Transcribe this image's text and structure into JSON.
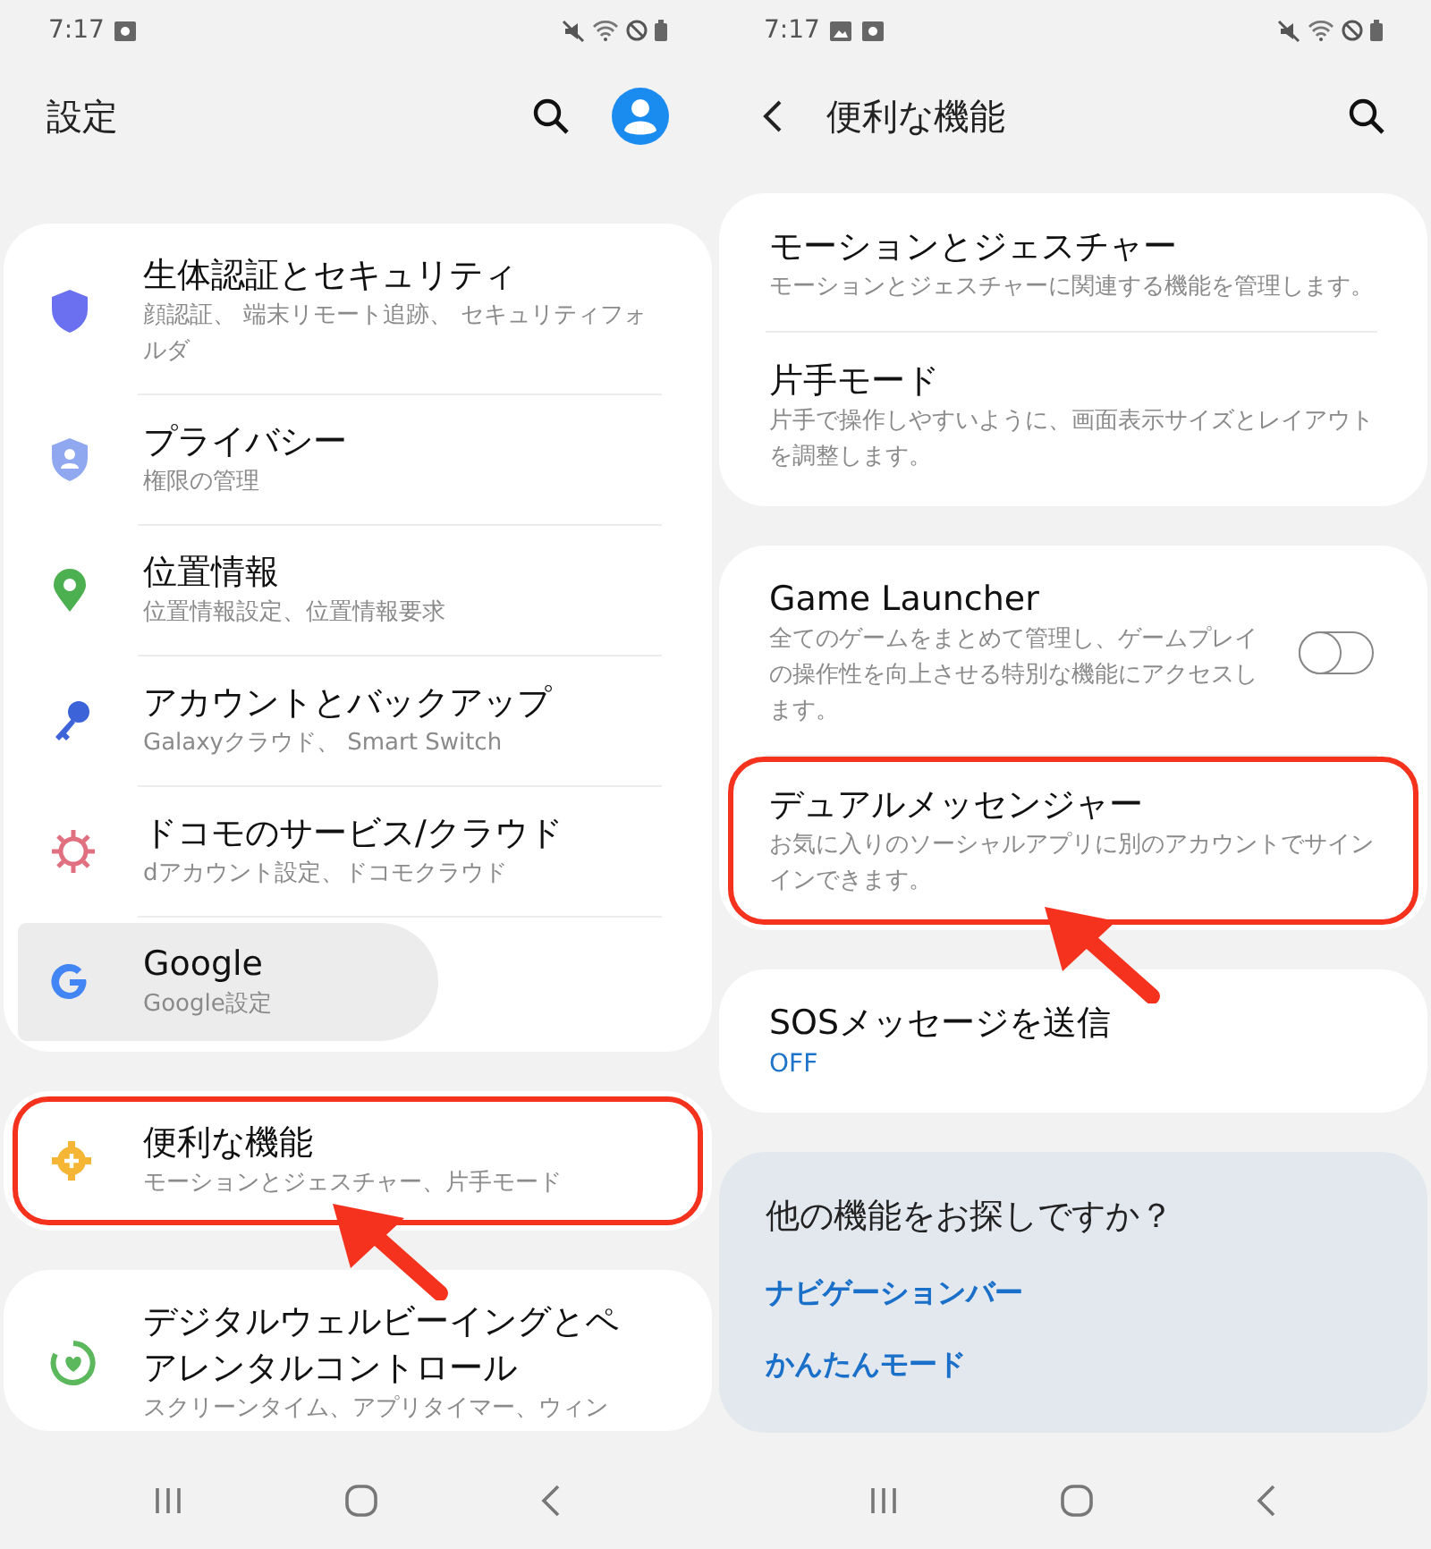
{
  "screens": [
    {
      "kind": "main",
      "status_bar": {
        "time": "7:17",
        "gallery_notification": false
      },
      "header": {
        "title": "設定"
      },
      "groups": [
        {
          "kind": "list",
          "items": [
            {
              "title": "生体認証とセキュリティ",
              "subtitle": "顔認証、 端末リモート追跡、 セキュリティフォルダ",
              "highlighted": false,
              "pressed": false
            },
            {
              "title": "プライバシー",
              "subtitle": "権限の管理",
              "highlighted": false,
              "pressed": false
            },
            {
              "title": "位置情報",
              "subtitle": "位置情報設定、位置情報要求",
              "highlighted": false,
              "pressed": false
            },
            {
              "title": "アカウントとバックアップ",
              "subtitle": "Galaxyクラウド、 Smart Switch",
              "highlighted": false,
              "pressed": false
            },
            {
              "title": "ドコモのサービス/クラウド",
              "subtitle": "dアカウント設定、ドコモクラウド",
              "highlighted": false,
              "pressed": false
            },
            {
              "title": "Google",
              "subtitle": "Google設定",
              "highlighted": false,
              "pressed": true
            }
          ]
        },
        {
          "kind": "list",
          "items": [
            {
              "title": "便利な機能",
              "subtitle": "モーションとジェスチャー、片手モード",
              "highlighted": true,
              "pressed": false
            }
          ]
        },
        {
          "kind": "list",
          "items": [
            {
              "title": "デジタルウェルビーイングとペアレンタルコントロール",
              "subtitle": "スクリーンタイム、アプリタイマー、ウィン",
              "highlighted": false,
              "pressed": false
            }
          ]
        }
      ]
    },
    {
      "kind": "sub",
      "status_bar": {
        "time": "7:17",
        "gallery_notification": true
      },
      "header": {
        "title": "便利な機能"
      },
      "groups": [
        {
          "kind": "list",
          "items": [
            {
              "title": "モーションとジェスチャー",
              "subtitle": "モーションとジェスチャーに関連する機能を管理します。",
              "highlighted": false
            },
            {
              "title": "片手モード",
              "subtitle": "片手で操作しやすいように、画面表示サイズとレイアウトを調整します。",
              "highlighted": false
            }
          ]
        },
        {
          "kind": "list",
          "items": [
            {
              "title": "Game Launcher",
              "subtitle": "全てのゲームをまとめて管理し、ゲームプレイの操作性を向上させる特別な機能にアクセスします。",
              "toggle": {
                "on": false
              },
              "highlighted": false
            },
            {
              "title": "デュアルメッセンジャー",
              "subtitle": "お気に入りのソーシャルアプリに別のアカウントでサインインできます。",
              "highlighted": true
            }
          ]
        },
        {
          "kind": "list",
          "items": [
            {
              "title": "SOSメッセージを送信",
              "status": "OFF",
              "highlighted": false
            }
          ]
        },
        {
          "kind": "suggestions",
          "title": "他の機能をお探しですか？",
          "links": [
            "ナビゲーションバー",
            "かんたんモード"
          ]
        }
      ]
    }
  ]
}
